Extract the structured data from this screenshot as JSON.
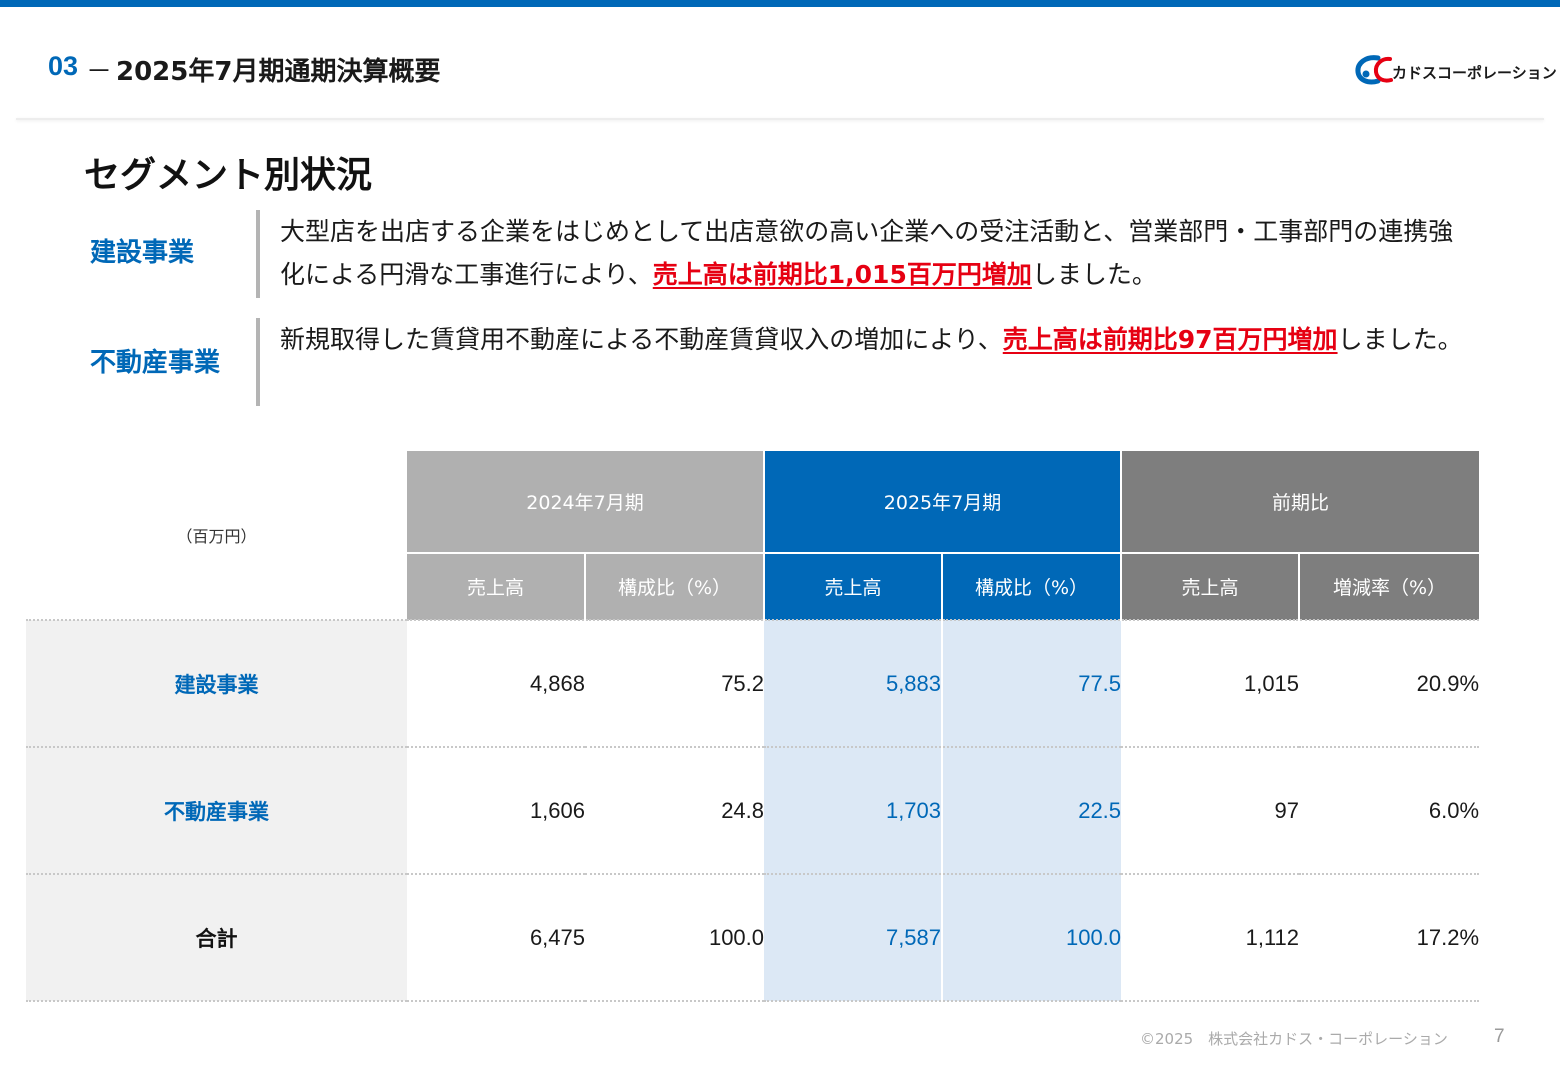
{
  "header": {
    "section_number": "03",
    "dash": "－",
    "title": "2025年7月期通期決算概要",
    "logo_text": "カドスコーポレーション"
  },
  "section_title": "セグメント別状況",
  "segments": [
    {
      "label": "建設事業",
      "text_before": "大型店を出店する企業をはじめとして出店意欲の高い企業への受注活動と、営業部門・工事部門の連携強化による円滑な工事進行により、",
      "highlight": "売上高は前期比1,015百万円増加",
      "text_after": "しました。"
    },
    {
      "label": "不動産事業",
      "text_before": "新規取得した賃貸用不動産による不動産賃貸収入の増加により、",
      "highlight": "売上高は前期比97百万円増加",
      "text_after": "しました。"
    }
  ],
  "table": {
    "unit": "（百万円）",
    "groups": [
      "2024年7月期",
      "2025年7月期",
      "前期比"
    ],
    "subheaders": [
      "売上高",
      "構成比（%）",
      "売上高",
      "構成比（%）",
      "売上高",
      "増減率（%）"
    ],
    "rows": [
      {
        "label": "建設事業",
        "cells": [
          "4,868",
          "75.2",
          "5,883",
          "77.5",
          "1,015",
          "20.9%"
        ]
      },
      {
        "label": "不動産事業",
        "cells": [
          "1,606",
          "24.8",
          "1,703",
          "22.5",
          "97",
          "6.0%"
        ]
      },
      {
        "label": "合計",
        "cells": [
          "6,475",
          "100.0",
          "7,587",
          "100.0",
          "1,112",
          "17.2%"
        ]
      }
    ]
  },
  "footer": {
    "copyright": "©2025　株式会社カドス・コーポレーション",
    "page_number": "7"
  },
  "colors": {
    "brand_blue": "#0068b7",
    "highlight_red": "#e60012",
    "header_gray_2024": "#b0b0b0",
    "header_gray_compare": "#7e7e7e",
    "cell_blue_tint": "#dce8f5"
  }
}
